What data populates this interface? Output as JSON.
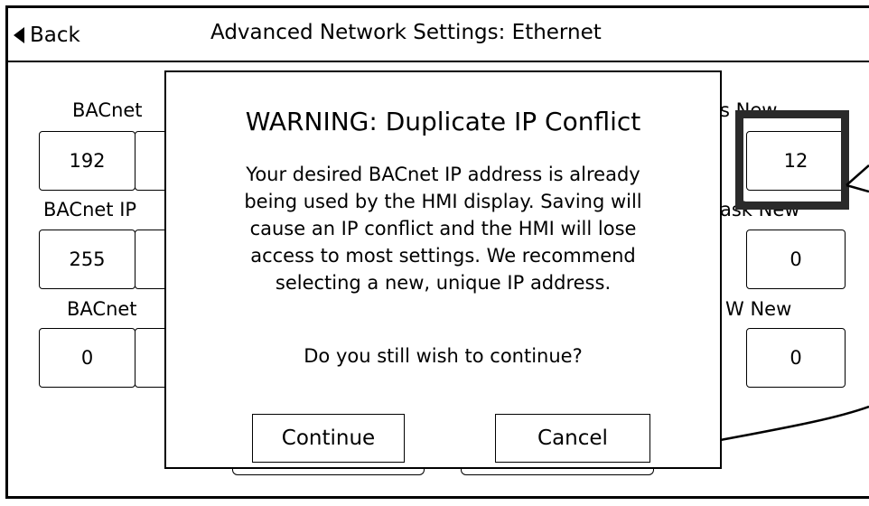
{
  "header": {
    "back_label": "Back",
    "title": "Advanced Network Settings: Ethernet"
  },
  "fields": [
    {
      "label": "BACnet",
      "values": [
        "192",
        "",
        "12"
      ],
      "right_label": "s New"
    },
    {
      "label": "BACnet IP",
      "values": [
        "255",
        "",
        "0"
      ],
      "right_label": "ask New"
    },
    {
      "label": "BACnet ",
      "values": [
        "0",
        "",
        "0"
      ],
      "right_label": "W New"
    }
  ],
  "dialog": {
    "title": "WARNING: Duplicate IP Conflict",
    "message_lines": [
      "Your desired BACnet IP address is already",
      "being used by the HMI display. Saving will",
      "cause an IP conflict and the HMI will lose",
      "access to most settings. We recommend",
      "selecting a new, unique IP address."
    ],
    "question": "Do you still wish to continue?",
    "continue_label": "Continue",
    "cancel_label": "Cancel"
  },
  "colors": {
    "highlight_border": "#2a2a2a",
    "line": "#000000"
  }
}
